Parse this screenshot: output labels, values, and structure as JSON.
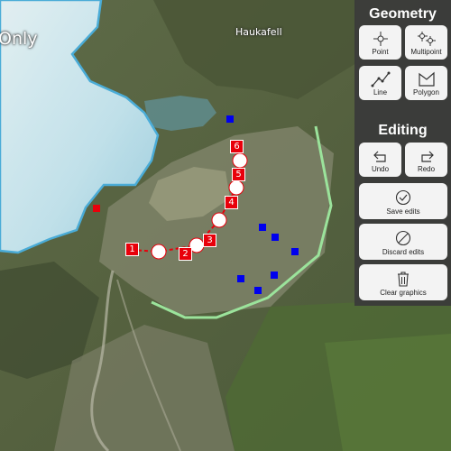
{
  "map": {
    "labels": {
      "glacier_partial": "Only",
      "place": "Haukafell"
    },
    "vertex_labels": [
      "1",
      "2",
      "3",
      "4",
      "5",
      "6"
    ],
    "colors": {
      "selection_red": "#e8000b",
      "point_blue": "#0000ee",
      "polyline_green": "#9be39b",
      "glacier_outline": "#4ab0df"
    }
  },
  "panel": {
    "geometry_title": "Geometry",
    "geometry_tools": [
      {
        "label": "Point",
        "icon": "point-icon"
      },
      {
        "label": "Multipoint",
        "icon": "multipoint-icon"
      },
      {
        "label": "Line",
        "icon": "line-icon"
      },
      {
        "label": "Polygon",
        "icon": "polygon-icon"
      }
    ],
    "editing_title": "Editing",
    "editing_tools": [
      {
        "label": "Undo",
        "icon": "undo-icon"
      },
      {
        "label": "Redo",
        "icon": "redo-icon"
      }
    ],
    "actions": [
      {
        "label": "Save edits",
        "icon": "checkmark-circle-icon"
      },
      {
        "label": "Discard edits",
        "icon": "circle-slash-icon"
      },
      {
        "label": "Clear graphics",
        "icon": "trash-icon"
      }
    ]
  }
}
